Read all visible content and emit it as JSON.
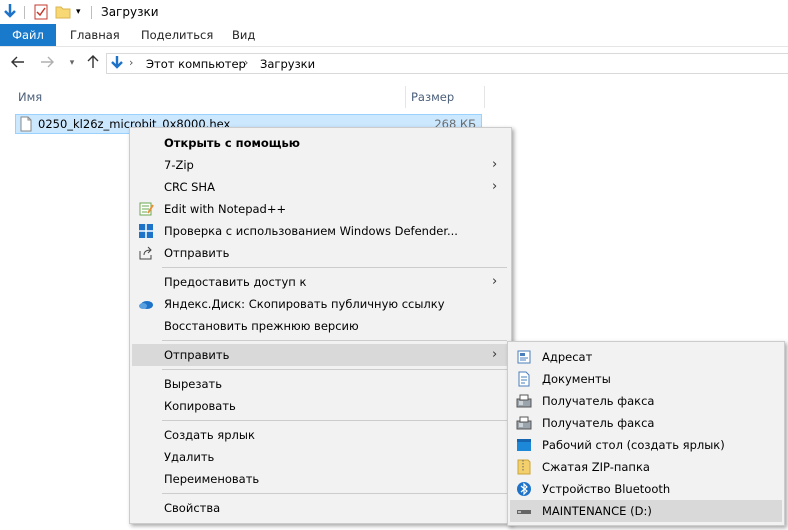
{
  "window": {
    "title": "Загрузки"
  },
  "ribbon": {
    "file": "Файл",
    "home": "Главная",
    "share": "Поделиться",
    "view": "Вид"
  },
  "address": {
    "crumbs": [
      "Этот компьютер",
      "Загрузки"
    ]
  },
  "columns": {
    "name": "Имя",
    "size": "Размер"
  },
  "file": {
    "name": "0250_kl26z_microbit_0x8000.hex",
    "size": "268 КБ"
  },
  "context_menu": {
    "open_with": "Открыть с помощью",
    "zip7": "7-Zip",
    "crc": "CRC SHA",
    "notepad": "Edit with Notepad++",
    "defender": "Проверка с использованием Windows Defender...",
    "share": "Отправить",
    "grant_access": "Предоставить доступ к",
    "yandex": "Яндекс.Диск: Скопировать публичную ссылку",
    "restore": "Восстановить прежнюю версию",
    "send_to": "Отправить",
    "cut": "Вырезать",
    "copy": "Копировать",
    "shortcut": "Создать ярлык",
    "delete": "Удалить",
    "rename": "Переименовать",
    "properties": "Свойства"
  },
  "submenu": {
    "items": [
      {
        "label": "Адресат",
        "icon": "contact-icon"
      },
      {
        "label": "Документы",
        "icon": "documents-icon"
      },
      {
        "label": "Получатель факса",
        "icon": "fax-icon"
      },
      {
        "label": "Получатель факса",
        "icon": "fax-icon"
      },
      {
        "label": "Рабочий стол (создать ярлык)",
        "icon": "desktop-icon"
      },
      {
        "label": "Сжатая ZIP-папка",
        "icon": "zip-folder-icon"
      },
      {
        "label": "Устройство Bluetooth",
        "icon": "bluetooth-icon"
      },
      {
        "label": "MAINTENANCE (D:)",
        "icon": "drive-icon"
      }
    ]
  },
  "colors": {
    "accent": "#1979ca",
    "selection": "#cce8ff",
    "menu_bg": "#f2f2f2",
    "menu_highlight": "#d9d9d9"
  }
}
